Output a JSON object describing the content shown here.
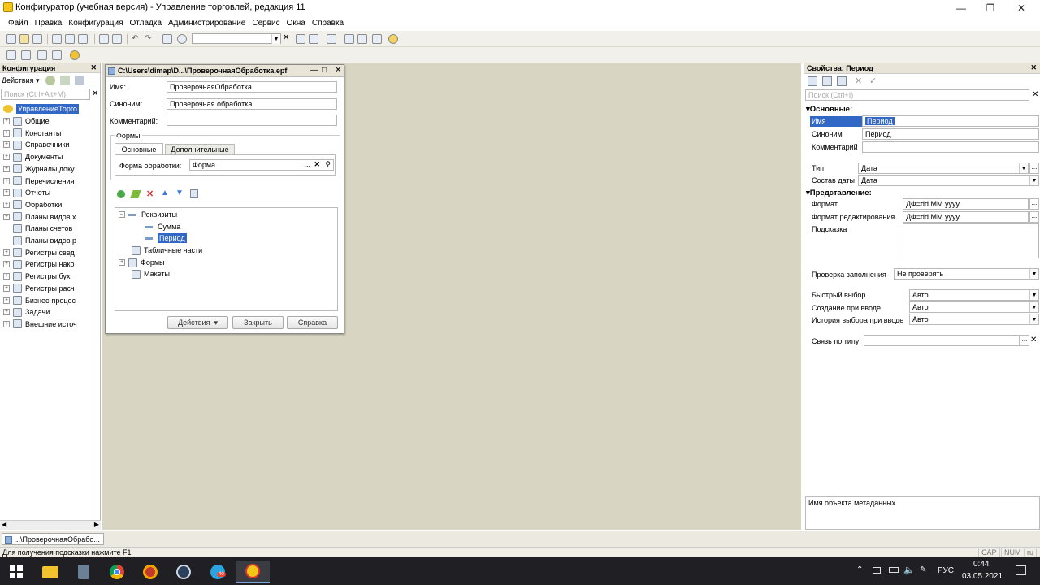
{
  "window": {
    "title": "Конфигуратор (учебная версия) - Управление торговлей, редакция 11"
  },
  "menu": [
    "Файл",
    "Правка",
    "Конфигурация",
    "Отладка",
    "Администрирование",
    "Сервис",
    "Окна",
    "Справка"
  ],
  "config_panel": {
    "title": "Конфигурация",
    "actions_label": "Действия",
    "search_placeholder": "Поиск (Ctrl+Alt+M)",
    "root": "УправлениеТорго",
    "items": [
      "Общие",
      "Константы",
      "Справочники",
      "Документы",
      "Журналы доку",
      "Перечисления",
      "Отчеты",
      "Обработки",
      "Планы видов х",
      "Планы счетов",
      "Планы видов р",
      "Регистры свед",
      "Регистры нако",
      "Регистры бухг",
      "Регистры расч",
      "Бизнес-процес",
      "Задачи",
      "Внешние источ"
    ]
  },
  "processing_window": {
    "title": "C:\\Users\\dimap\\D...\\ПроверочнаяОбработка.epf",
    "name_label": "Имя:",
    "name_value": "ПроверочнаяОбработка",
    "synonym_label": "Синоним:",
    "synonym_value": "Проверочная обработка",
    "comment_label": "Комментарий:",
    "comment_value": "",
    "forms_group": "Формы",
    "tab_main": "Основные",
    "tab_extra": "Дополнительные",
    "form_label": "Форма обработки:",
    "form_value": "Форма",
    "tree": {
      "attributes": "Реквизиты",
      "attr1": "Сумма",
      "attr2": "Период",
      "tables": "Табличные части",
      "forms": "Формы",
      "layouts": "Макеты"
    },
    "btn_actions": "Действия",
    "btn_close": "Закрыть",
    "btn_help": "Справка"
  },
  "properties": {
    "title": "Свойства: Период",
    "search_placeholder": "Поиск (Ctrl+I)",
    "section_main": "Основные:",
    "name_label": "Имя",
    "name_value": "Период",
    "synonym_label": "Синоним",
    "synonym_value": "Период",
    "comment_label": "Комментарий",
    "comment_value": "",
    "type_label": "Тип",
    "type_value": "Дата",
    "date_comp_label": "Состав даты",
    "date_comp_value": "Дата",
    "section_view": "Представление:",
    "format_label": "Формат",
    "format_value": "ДФ=dd.MM.yyyy",
    "edit_format_label": "Формат редактирования",
    "edit_format_value": "ДФ=dd.MM.yyyy",
    "hint_label": "Подсказка",
    "fill_check_label": "Проверка заполнения",
    "fill_check_value": "Не проверять",
    "quick_choice_label": "Быстрый выбор",
    "quick_choice_value": "Авто",
    "create_on_input_label": "Создание при вводе",
    "create_on_input_value": "Авто",
    "choice_history_label": "История выбора при вводе",
    "choice_history_value": "Авто",
    "type_link_label": "Связь по типу",
    "description": "Имя объекта метаданных"
  },
  "mdi_tab": "...\\ПроверочнаяОбрабо...",
  "status": {
    "hint": "Для получения подсказки нажмите F1",
    "cap": "CAP",
    "num": "NUM",
    "lang": "ru"
  },
  "tray": {
    "lang": "РУС",
    "time": "0:44",
    "date": "03.05.2021",
    "badge": "40"
  },
  "colors": {
    "selection": "#3168c6",
    "mdi_bg": "#d9d5c3",
    "taskbar": "#1f1f24"
  }
}
